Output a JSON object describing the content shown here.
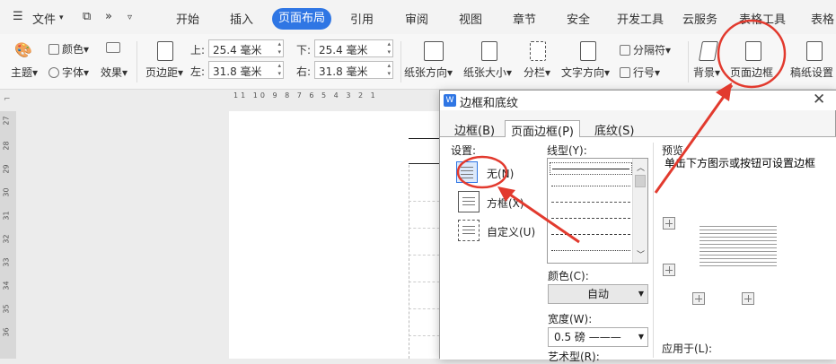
{
  "topbar": {
    "menu_label": "文件",
    "tabs": [
      "开始",
      "插入",
      "页面布局",
      "引用",
      "审阅",
      "视图",
      "章节",
      "安全",
      "开发工具",
      "云服务",
      "表格工具",
      "表格"
    ]
  },
  "ribbon": {
    "color_label": "颜色",
    "theme_label": "主题",
    "font_label": "字体",
    "effect_label": "效果",
    "margin_label": "页边距",
    "top_label": "上:",
    "top_value": "25.4 毫米",
    "bottom_label": "下:",
    "bottom_value": "25.4 毫米",
    "left_label": "左:",
    "left_value": "31.8 毫米",
    "right_label": "右:",
    "right_value": "31.8 毫米",
    "orientation_label": "纸张方向",
    "size_label": "纸张大小",
    "columns_label": "分栏",
    "text_direction_label": "文字方向",
    "separator_label": "分隔符",
    "line_number_label": "行号",
    "background_label": "背景",
    "page_border_label": "页面边框",
    "manuscript_label": "稿纸设置"
  },
  "hruler": {
    "numbers": [
      "11",
      "10",
      "9",
      "8",
      "7",
      "6",
      "5",
      "4",
      "3",
      "2",
      "1"
    ]
  },
  "vruler": {
    "numbers": [
      "27",
      "28",
      "29",
      "30",
      "31",
      "32",
      "33",
      "34",
      "35",
      "36"
    ]
  },
  "dialog": {
    "title": "边框和底纹",
    "tabs": [
      "边框(B)",
      "页面边框(P)",
      "底纹(S)"
    ],
    "setting_label": "设置:",
    "settings": [
      "无(N)",
      "方框(X)",
      "自定义(U)"
    ],
    "line_style_label": "线型(Y):",
    "color_label": "颜色(C):",
    "color_value": "自动",
    "width_label": "宽度(W):",
    "width_value": "0.5  磅 ———",
    "art_label": "艺术型(R):",
    "preview_label": "预览",
    "preview_hint": "单击下方图示或按钮可设置边框",
    "apply_to_label": "应用于(L):"
  },
  "colors": {
    "accent": "#2f76e4",
    "annotation": "#e23a2e"
  }
}
